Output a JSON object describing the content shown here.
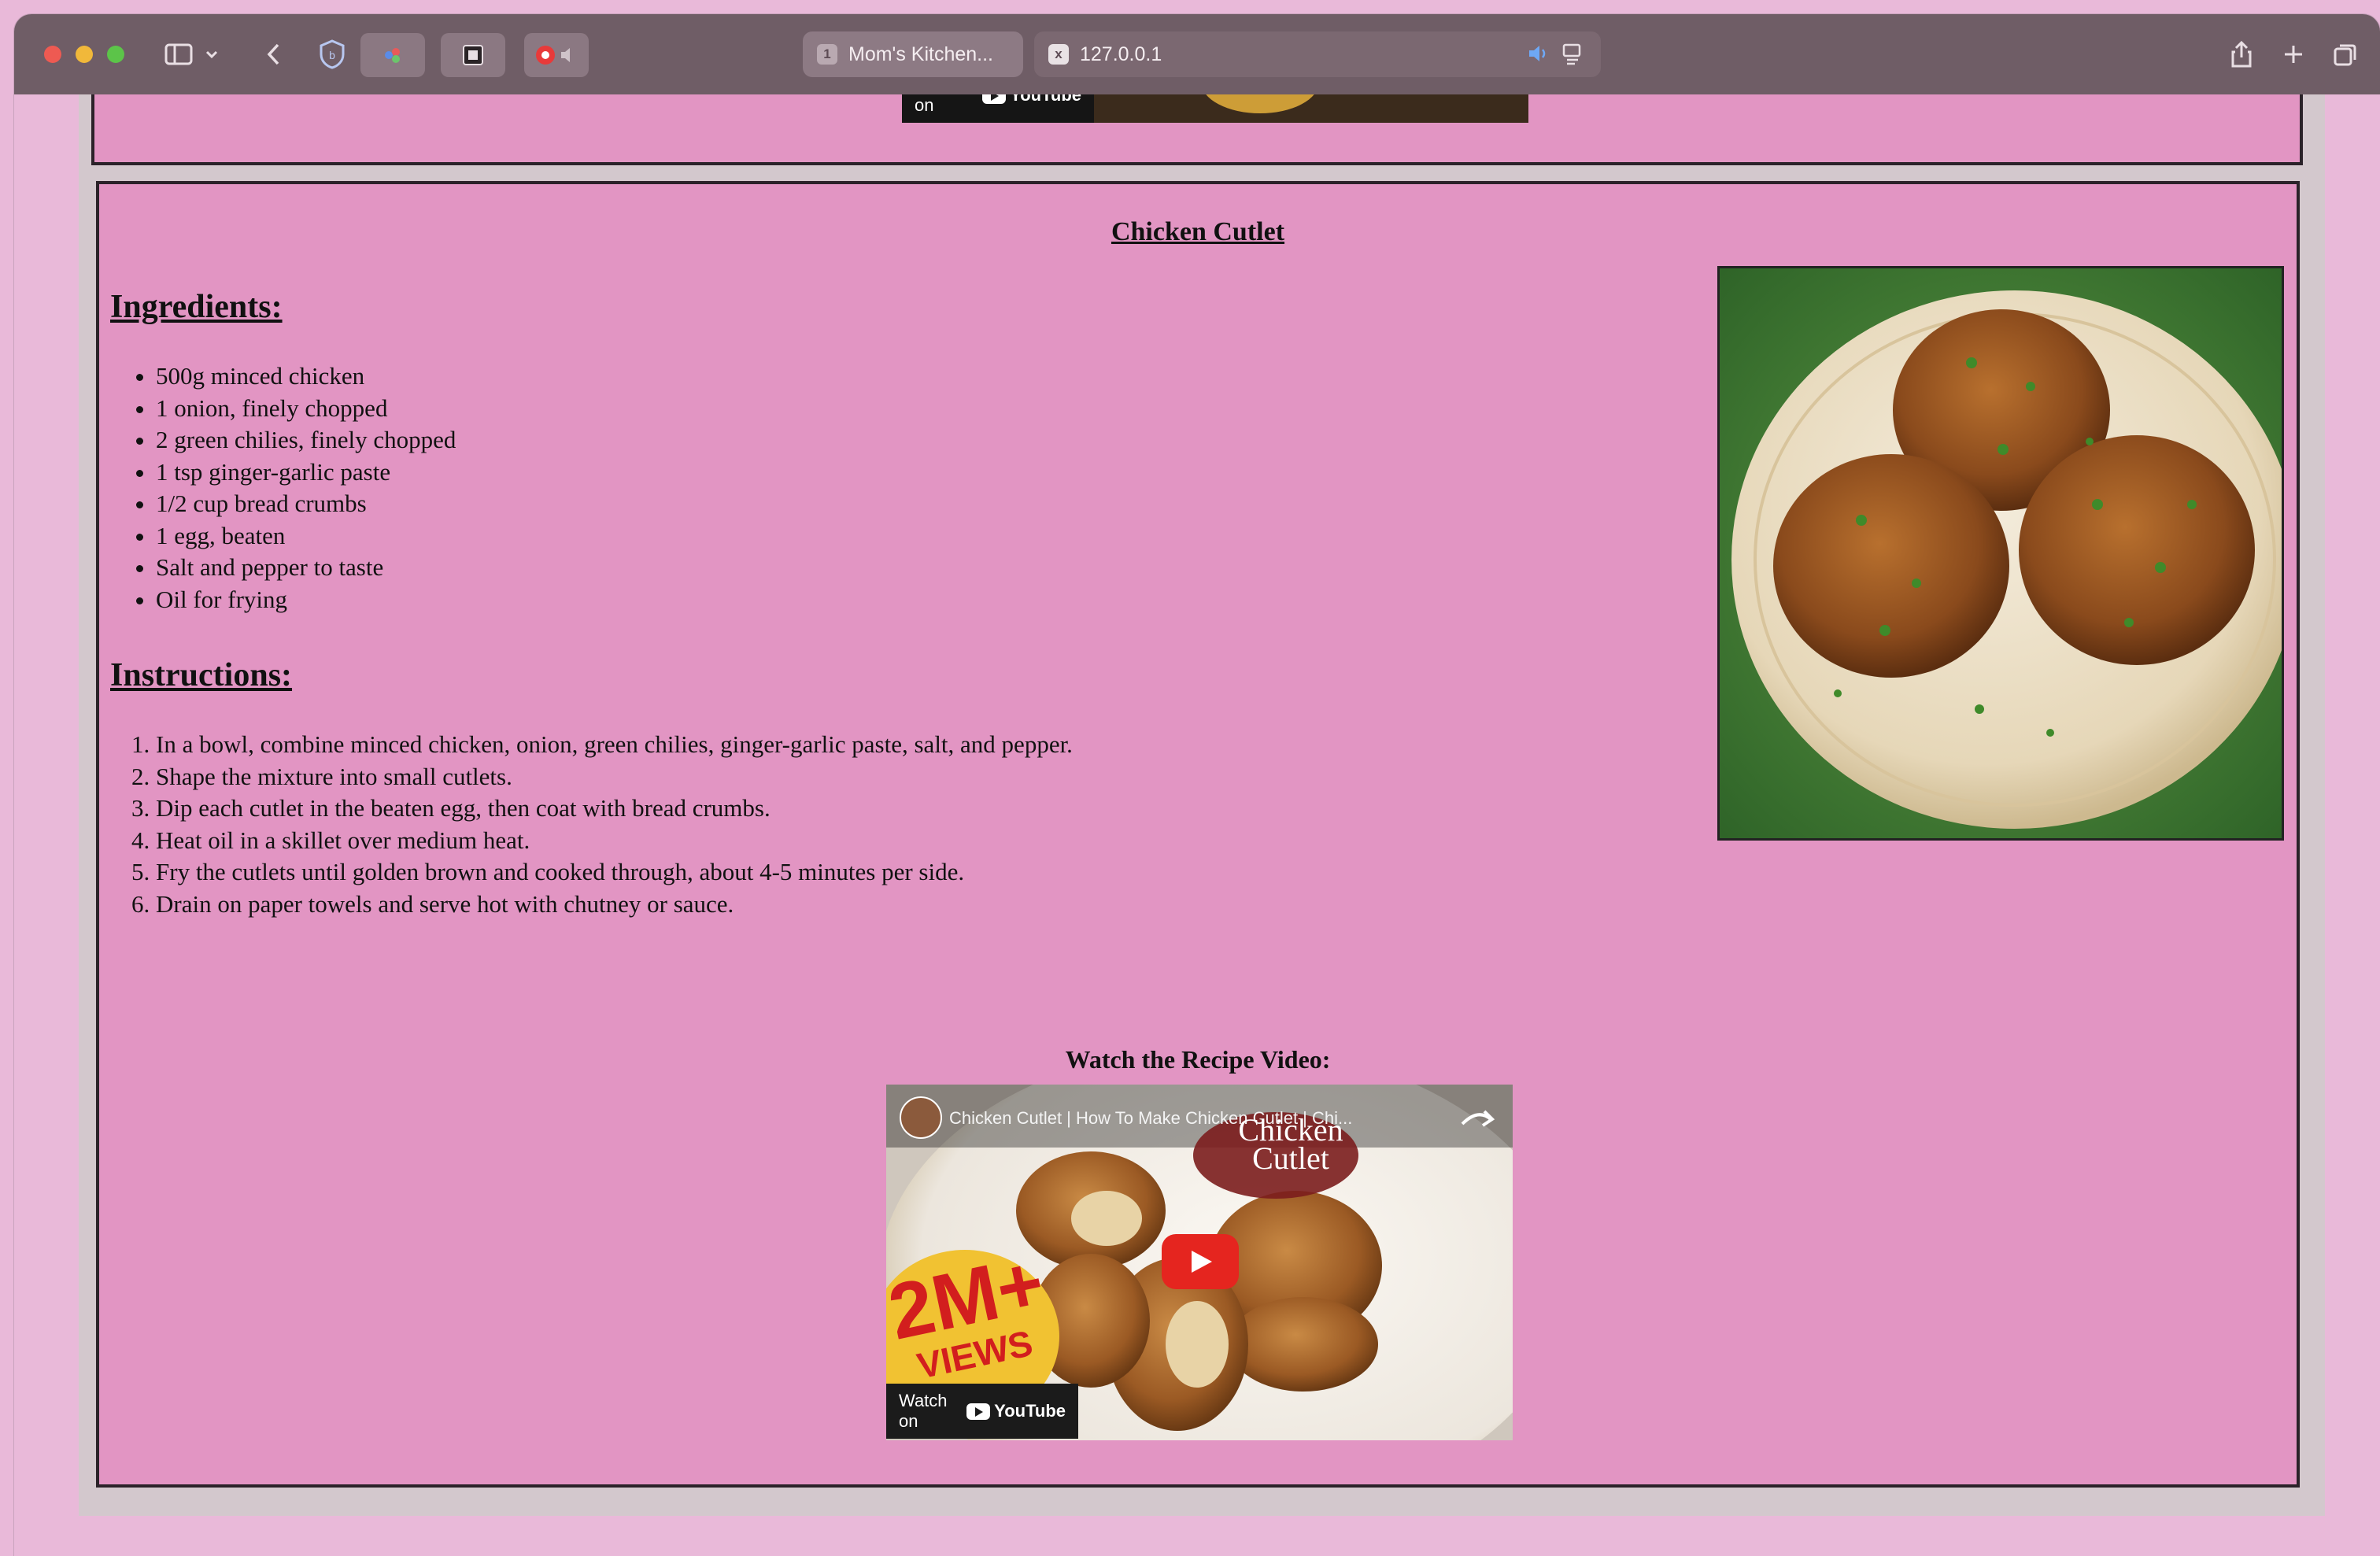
{
  "browser": {
    "tabs": [
      {
        "label": "Mom's Kitchen...",
        "favicon": "1",
        "active": true
      },
      {
        "label": "127.0.0.1",
        "favicon": "x",
        "active": false
      }
    ]
  },
  "previous_video": {
    "watch_on": "Watch on",
    "youtube": "YouTube"
  },
  "recipe": {
    "title": "Chicken Cutlet",
    "ingredients_heading": "Ingredients:",
    "ingredients": [
      "500g minced chicken",
      "1 onion, finely chopped",
      "2 green chilies, finely chopped",
      "1 tsp ginger-garlic paste",
      "1/2 cup bread crumbs",
      "1 egg, beaten",
      "Salt and pepper to taste",
      "Oil for frying"
    ],
    "instructions_heading": "Instructions:",
    "instructions": [
      "In a bowl, combine minced chicken, onion, green chilies, ginger-garlic paste, salt, and pepper.",
      "Shape the mixture into small cutlets.",
      "Dip each cutlet in the beaten egg, then coat with bread crumbs.",
      "Heat oil in a skillet over medium heat.",
      "Fry the cutlets until golden brown and cooked through, about 4-5 minutes per side.",
      "Drain on paper towels and serve hot with chutney or sauce."
    ],
    "video_label": "Watch the Recipe Video:",
    "video": {
      "title": "Chicken Cutlet | How To Make Chicken Cutlet | Chi...",
      "overlay_title_line1": "Chicken",
      "overlay_title_line2": "Cutlet",
      "badge_big": "2M+",
      "badge_small": "VIEWS",
      "watch_on": "Watch on",
      "youtube": "YouTube"
    }
  },
  "colors": {
    "page_background": "#e9b9d9",
    "box_background": "#e295c3",
    "toolbar": "#6f5d66"
  }
}
